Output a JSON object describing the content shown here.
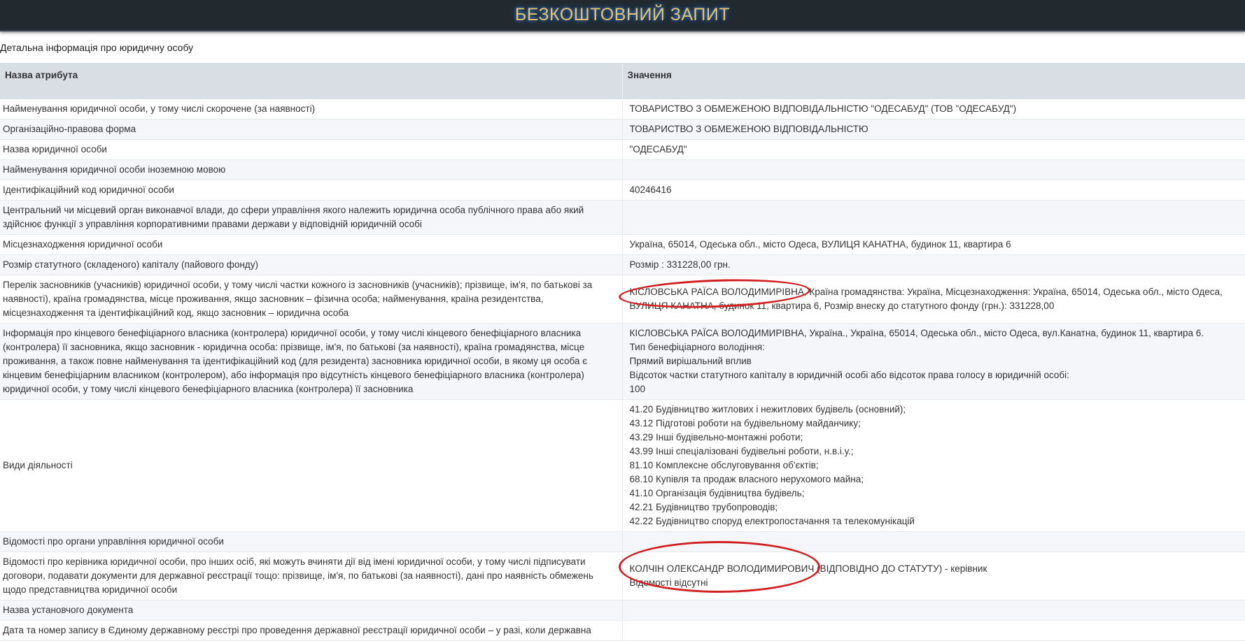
{
  "header": {
    "title": "БЕЗКОШТОВНИЙ ЗАПИТ"
  },
  "subtitle": "Детальна інформація про юридичну особу",
  "table": {
    "col_attr": "Назва атрибута",
    "col_value": "Значення",
    "rows": [
      {
        "attr": "Найменування юридичної особи, у тому числі скорочене (за наявності)",
        "value": [
          "ТОВАРИСТВО З ОБМЕЖЕНОЮ ВІДПОВІДАЛЬНІСТЮ \"ОДЕСАБУД\" (ТОВ \"ОДЕСАБУД\")"
        ]
      },
      {
        "attr": "Організаційно-правова форма",
        "value": [
          "ТОВАРИСТВО З ОБМЕЖЕНОЮ ВІДПОВІДАЛЬНІСТЮ"
        ]
      },
      {
        "attr": "Назва юридичної особи",
        "value": [
          "\"ОДЕСАБУД\""
        ]
      },
      {
        "attr": "Найменування юридичної особи іноземною мовою",
        "value": [
          ""
        ]
      },
      {
        "attr": "Ідентифікаційний код юридичної особи",
        "value": [
          "40246416"
        ]
      },
      {
        "attr": "Центральний чи місцевий орган виконавчої влади, до сфери управління якого належить юридична особа публічного права або який здійснює функції з управління корпоративними правами держави у відповідній юридичній особі",
        "value": [
          ""
        ]
      },
      {
        "attr": "Місцезнаходження юридичної особи",
        "value": [
          "Україна, 65014, Одеська обл., місто Одеса, ВУЛИЦЯ КАНАТНА, будинок 11, квартира 6"
        ]
      },
      {
        "attr": "Розмір статутного (складеного) капіталу (пайового фонду)",
        "value": [
          "Розмір : 331228,00 грн."
        ]
      },
      {
        "attr": "Перелік засновників (учасників) юридичної особи, у тому числі частки кожного із засновників (учасників); прізвище, ім'я, по батькові за наявності), країна громадянства, місце проживання, якщо засновник – фізична особа; найменування, країна резидентства, місцезнаходження та ідентифікаційний код, якщо засновник – юридична особа",
        "value": [
          "КІСЛОВСЬКА РАЇСА ВОЛОДИМИРІВНА, Країна громадянства: Україна, Місцезнаходження: Україна, 65014, Одеська обл., місто Одеса, ВУЛИЦЯ КАНАТНА, будинок 11, квартира 6, Розмір внеску до статутного фонду (грн.): 331228,00"
        ]
      },
      {
        "attr": "Інформація про кінцевого бенефіціарного власника (контролера) юридичної особи, у тому числі кінцевого бенефіціарного власника (контролера) її засновника, якщо засновник - юридична особа: прізвище, ім'я, по батькові (за наявності), країна громадянства, місце проживання, а також повне найменування та ідентифікаційний код (для резидента) засновника юридичної особи, в якому ця особа є кінцевим бенефіціарним власником (контролером), або інформація про відсутність кінцевого бенефіціарного власника (контролера) юридичної особи, у тому числі кінцевого бенефіціарного власника (контролера) її засновника",
        "value": [
          "КІСЛОВСЬКА РАЇСА ВОЛОДИМИРІВНА, Україна., Україна, 65014, Одеська обл., місто Одеса, вул.Канатна, будинок 11, квартира 6.",
          "Тип бенефіціарного володіння:",
          "Прямий вирішальний вплив",
          "Відсоток частки статутного капіталу в юридичній особі або відсоток права голосу в юридичній особі:",
          "100"
        ]
      },
      {
        "attr": "Види діяльності",
        "value": [
          "41.20 Будівництво житлових і нежитлових будівель (основний);",
          "43.12 Підготові роботи на будівельному майданчику;",
          "43.29 Інші будівельно-монтажні роботи;",
          "43.99 Інші спеціалізовані будівельні роботи, н.в.і.у.;",
          "81.10 Комплексне обслуговування об'єктів;",
          "68.10 Купівля та продаж власного нерухомого майна;",
          "41.10 Організація будівництва будівель;",
          "42.21 Будівництво трубопроводів;",
          "42.22 Будівництво споруд електропостачання та телекомунікацій"
        ]
      },
      {
        "attr": "Відомості про органи управління юридичної особи",
        "value": [
          ""
        ]
      },
      {
        "attr": "Відомості про керівника юридичної особи, про інших осіб, які можуть вчиняти дії від імені юридичної особи, у тому числі підписувати договори, подавати документи для державної реєстрації тощо: прізвище, ім'я, по батькові (за наявності), дані про наявність обмежень щодо представництва юридичної особи",
        "value": [
          "КОЛЧІН ОЛЕКСАНДР ВОЛОДИМИРОВИЧ (ВІДПОВІДНО ДО СТАТУТУ) - керівник",
          "Відомості відсутні"
        ]
      },
      {
        "attr": "Назва установчого документа",
        "value": [
          ""
        ]
      },
      {
        "attr": "Дата та номер запису в Єдиному державному реєстрі про проведення державної реєстрації юридичної особи – у разі, коли державна",
        "value": [
          ""
        ]
      }
    ]
  },
  "colors": {
    "header_bg": "#222a30",
    "title": "#e7c46a",
    "annotation": "#d02020"
  }
}
